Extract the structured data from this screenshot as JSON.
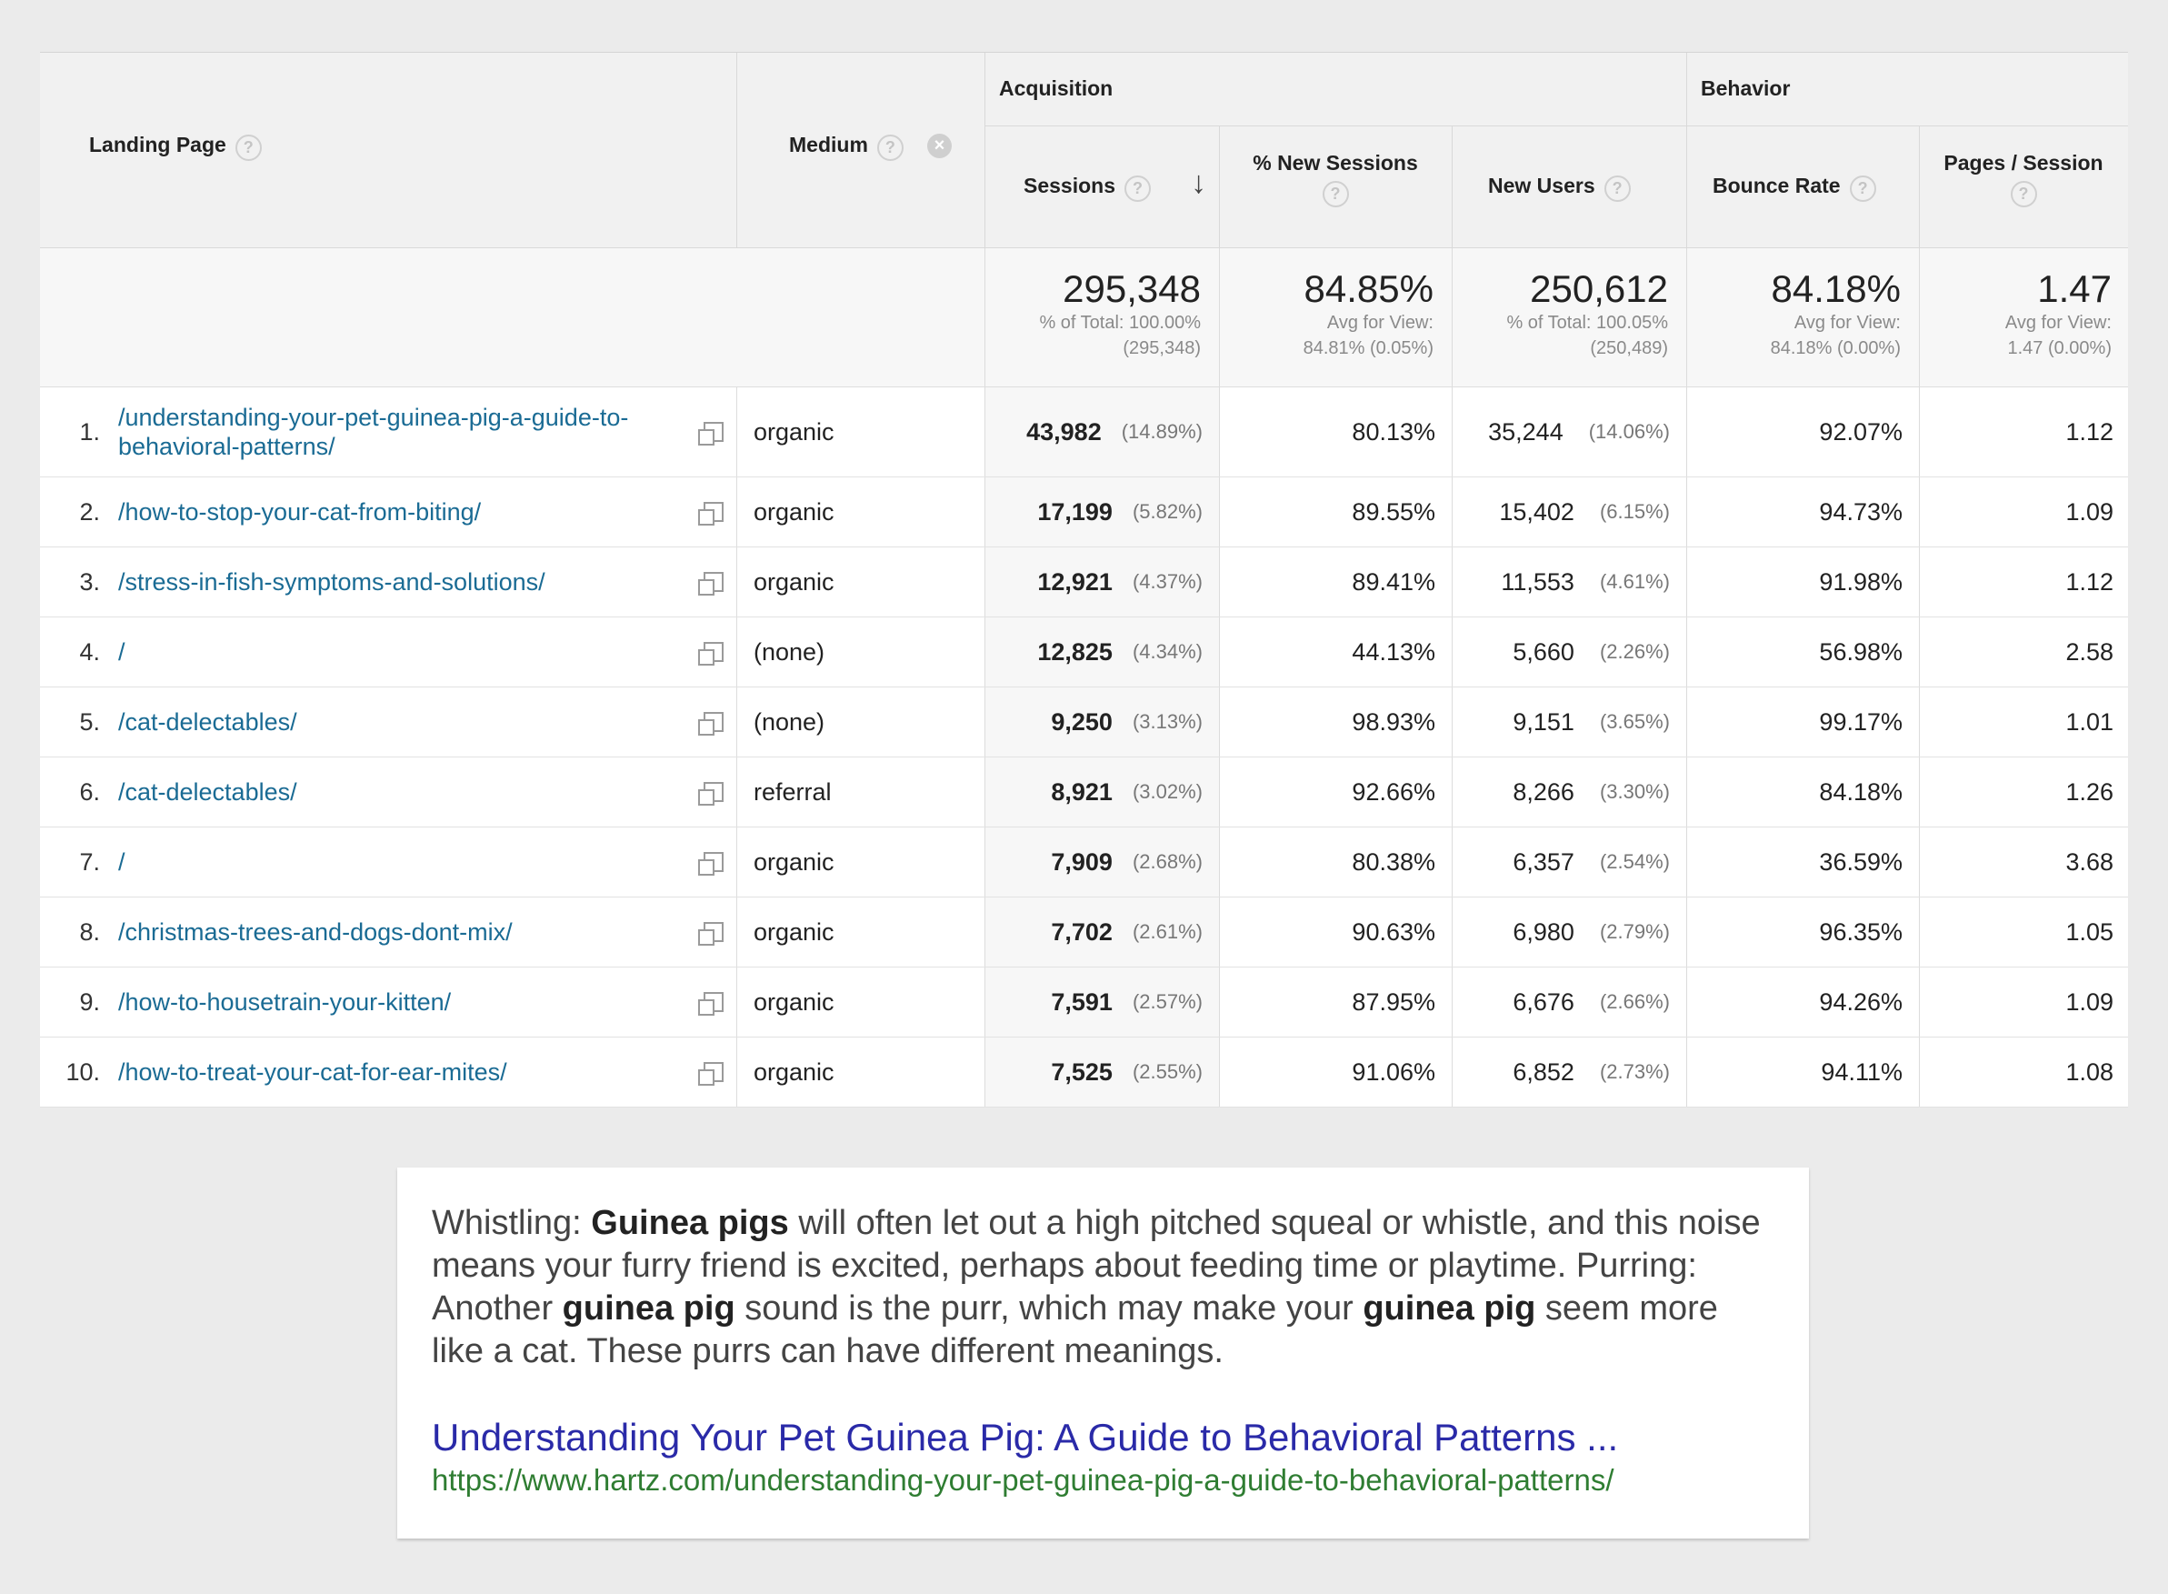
{
  "headers": {
    "landing_page": "Landing Page",
    "medium": "Medium",
    "acquisition": "Acquisition",
    "behavior": "Behavior",
    "sessions": "Sessions",
    "new_sessions": "% New Sessions",
    "new_users": "New Users",
    "bounce_rate": "Bounce Rate",
    "pages_session": "Pages / Session",
    "help_glyph": "?",
    "sort_glyph": "↓",
    "remove_glyph": "×"
  },
  "totals": {
    "sessions": {
      "value": "295,348",
      "line1": "% of Total: 100.00%",
      "line2": "(295,348)"
    },
    "new_sessions": {
      "value": "84.85%",
      "line1": "Avg for View:",
      "line2": "84.81% (0.05%)"
    },
    "new_users": {
      "value": "250,612",
      "line1": "% of Total: 100.05%",
      "line2": "(250,489)"
    },
    "bounce_rate": {
      "value": "84.18%",
      "line1": "Avg for View:",
      "line2": "84.18% (0.00%)"
    },
    "pages_session": {
      "value": "1.47",
      "line1": "Avg for View:",
      "line2": "1.47 (0.00%)"
    }
  },
  "rows": [
    {
      "idx": "1.",
      "page": "/understanding-your-pet-guinea-pig-a-guide-to-behavioral-patterns/",
      "medium": "organic",
      "sessions": "43,982",
      "sessions_pct": "(14.89%)",
      "new_sessions": "80.13%",
      "new_users": "35,244",
      "new_users_pct": "(14.06%)",
      "bounce": "92.07%",
      "pps": "1.12"
    },
    {
      "idx": "2.",
      "page": "/how-to-stop-your-cat-from-biting/",
      "medium": "organic",
      "sessions": "17,199",
      "sessions_pct": "(5.82%)",
      "new_sessions": "89.55%",
      "new_users": "15,402",
      "new_users_pct": "(6.15%)",
      "bounce": "94.73%",
      "pps": "1.09"
    },
    {
      "idx": "3.",
      "page": "/stress-in-fish-symptoms-and-solutions/",
      "medium": "organic",
      "sessions": "12,921",
      "sessions_pct": "(4.37%)",
      "new_sessions": "89.41%",
      "new_users": "11,553",
      "new_users_pct": "(4.61%)",
      "bounce": "91.98%",
      "pps": "1.12"
    },
    {
      "idx": "4.",
      "page": "/",
      "medium": "(none)",
      "sessions": "12,825",
      "sessions_pct": "(4.34%)",
      "new_sessions": "44.13%",
      "new_users": "5,660",
      "new_users_pct": "(2.26%)",
      "bounce": "56.98%",
      "pps": "2.58"
    },
    {
      "idx": "5.",
      "page": "/cat-delectables/",
      "medium": "(none)",
      "sessions": "9,250",
      "sessions_pct": "(3.13%)",
      "new_sessions": "98.93%",
      "new_users": "9,151",
      "new_users_pct": "(3.65%)",
      "bounce": "99.17%",
      "pps": "1.01"
    },
    {
      "idx": "6.",
      "page": "/cat-delectables/",
      "medium": "referral",
      "sessions": "8,921",
      "sessions_pct": "(3.02%)",
      "new_sessions": "92.66%",
      "new_users": "8,266",
      "new_users_pct": "(3.30%)",
      "bounce": "84.18%",
      "pps": "1.26"
    },
    {
      "idx": "7.",
      "page": "/",
      "medium": "organic",
      "sessions": "7,909",
      "sessions_pct": "(2.68%)",
      "new_sessions": "80.38%",
      "new_users": "6,357",
      "new_users_pct": "(2.54%)",
      "bounce": "36.59%",
      "pps": "3.68"
    },
    {
      "idx": "8.",
      "page": "/christmas-trees-and-dogs-dont-mix/",
      "medium": "organic",
      "sessions": "7,702",
      "sessions_pct": "(2.61%)",
      "new_sessions": "90.63%",
      "new_users": "6,980",
      "new_users_pct": "(2.79%)",
      "bounce": "96.35%",
      "pps": "1.05"
    },
    {
      "idx": "9.",
      "page": "/how-to-housetrain-your-kitten/",
      "medium": "organic",
      "sessions": "7,591",
      "sessions_pct": "(2.57%)",
      "new_sessions": "87.95%",
      "new_users": "6,676",
      "new_users_pct": "(2.66%)",
      "bounce": "94.26%",
      "pps": "1.09"
    },
    {
      "idx": "10.",
      "page": "/how-to-treat-your-cat-for-ear-mites/",
      "medium": "organic",
      "sessions": "7,525",
      "sessions_pct": "(2.55%)",
      "new_sessions": "91.06%",
      "new_users": "6,852",
      "new_users_pct": "(2.73%)",
      "bounce": "94.11%",
      "pps": "1.08"
    }
  ],
  "snippet": {
    "t1": "Whistling: ",
    "b1": "Guinea pigs",
    "t2": " will often let out a high pitched squeal or whistle, and this noise means your furry friend is excited, perhaps about feeding time or playtime. Purring: Another ",
    "b2": "guinea pig",
    "t3": " sound is the purr, which may make your ",
    "b3": "guinea pig",
    "t4": " seem more like a cat. These purrs can have different meanings.",
    "title": "Understanding Your Pet Guinea Pig: A Guide to Behavioral Patterns ...",
    "url": "https://www.hartz.com/understanding-your-pet-guinea-pig-a-guide-to-behavioral-patterns/"
  },
  "colors": {
    "link": "#1a6b94",
    "snippet_title": "#2a2aa8",
    "snippet_url": "#2f7d32",
    "background": "#ebebeb"
  }
}
